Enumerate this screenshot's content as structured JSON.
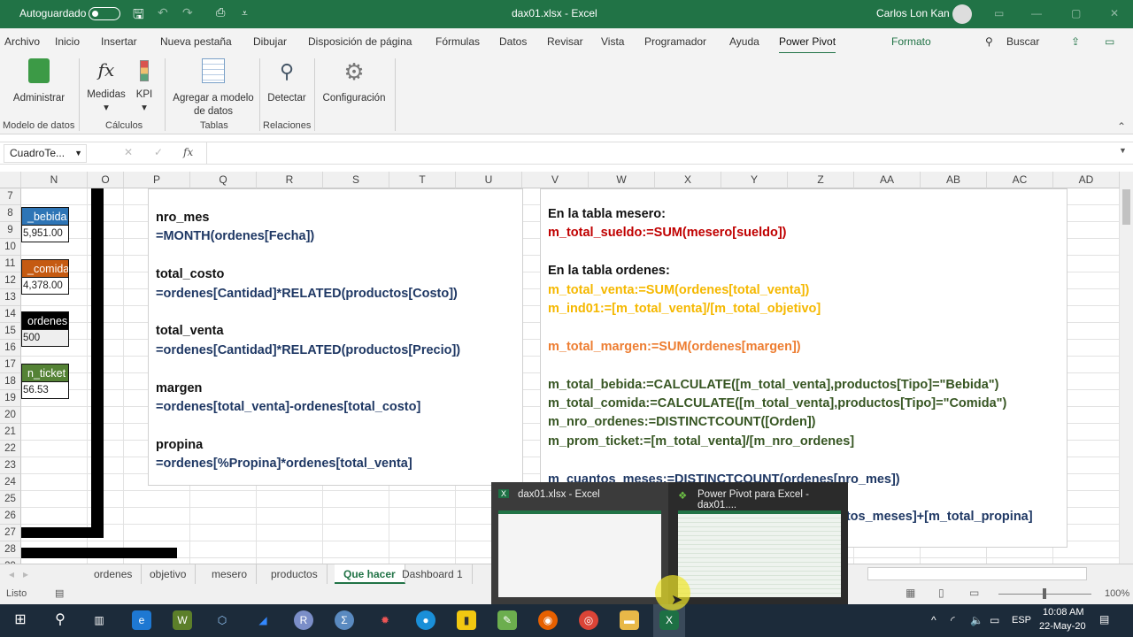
{
  "titlebar": {
    "autosave": "Autoguardado",
    "filename": "dax01.xlsx - Excel",
    "user": "Carlos Lon Kan"
  },
  "menu": [
    "Archivo",
    "Inicio",
    "Insertar",
    "Nueva pestaña",
    "Dibujar",
    "Disposición de página",
    "Fórmulas",
    "Datos",
    "Revisar",
    "Vista",
    "Programador",
    "Ayuda",
    "Power Pivot",
    "Formato"
  ],
  "search": "Buscar",
  "ribbon": {
    "administrar": "Administrar",
    "medidas": "Medidas",
    "kpi": "KPI",
    "agregar": "Agregar a modelo de datos",
    "detectar": "Detectar",
    "configuracion": "Configuración",
    "groups": {
      "modelo": "Modelo de datos",
      "calculos": "Cálculos",
      "tablas": "Tablas",
      "relaciones": "Relaciones"
    }
  },
  "formula_bar": {
    "name_box": "CuadroTe...",
    "fx": "fx",
    "value": ""
  },
  "columns": [
    "N",
    "O",
    "P",
    "Q",
    "R",
    "S",
    "T",
    "U",
    "V",
    "W",
    "X",
    "Y",
    "Z",
    "AA",
    "AB",
    "AC",
    "AD"
  ],
  "rows": [
    "7",
    "8",
    "9",
    "10",
    "11",
    "12",
    "13",
    "14",
    "15",
    "16",
    "17",
    "18",
    "19",
    "20",
    "21",
    "22",
    "23",
    "24",
    "25",
    "26",
    "27",
    "28",
    "29"
  ],
  "kpis": [
    {
      "label": "_bebida",
      "value": "5,951.00",
      "color": "#2e75b6"
    },
    {
      "label": "_comida",
      "value": "4,378.00",
      "color": "#c55a11"
    },
    {
      "label": "ordenes",
      "value": "500",
      "color": "#000000"
    },
    {
      "label": "n_ticket",
      "value": "56.53",
      "color": "#548235"
    }
  ],
  "left_box": [
    {
      "name": "nro_mes",
      "formula": "=MONTH(ordenes[Fecha])"
    },
    {
      "name": "total_costo",
      "formula": "=ordenes[Cantidad]*RELATED(productos[Costo])"
    },
    {
      "name": "total_venta",
      "formula": "=ordenes[Cantidad]*RELATED(productos[Precio])"
    },
    {
      "name": "margen",
      "formula": "=ordenes[total_venta]-ordenes[total_costo]"
    },
    {
      "name": "propina",
      "formula": "=ordenes[%Propina]*ordenes[total_venta]"
    }
  ],
  "right_box": {
    "h1": "En la tabla mesero:",
    "l1": "m_total_sueldo:=SUM(mesero[sueldo])",
    "h2": "En la tabla ordenes:",
    "l2": "m_total_venta:=SUM(ordenes[total_venta])",
    "l3": "m_ind01:=[m_total_venta]/[m_total_objetivo]",
    "l4": "m_total_margen:=SUM(ordenes[margen])",
    "l5": "m_total_bebida:=CALCULATE([m_total_venta],productos[Tipo]=\"Bebida\")",
    "l6": "m_total_comida:=CALCULATE([m_total_venta],productos[Tipo]=\"Comida\")",
    "l7": "m_nro_ordenes:=DISTINCTCOUNT([Orden])",
    "l8": "m_prom_ticket:=[m_total_venta]/[m_nro_ordenes]",
    "l9": "m_cuantos_meses:=DISTINCTCOUNT(ordenes[nro_mes])",
    "l10": "ntos_meses]+[m_total_propina]"
  },
  "sheet_tabs": [
    "ordenes",
    "objetivo",
    "mesero",
    "productos",
    "Que hacer",
    "Dashboard 1"
  ],
  "active_tab": "Que hacer",
  "status": {
    "ready": "Listo",
    "zoom": "100%"
  },
  "popup": {
    "excel": "dax01.xlsx - Excel",
    "powerpivot": "Power Pivot para Excel - dax01...."
  },
  "taskbar": {
    "lang": "ESP",
    "time": "10:08 AM",
    "date": "22-May-20"
  }
}
